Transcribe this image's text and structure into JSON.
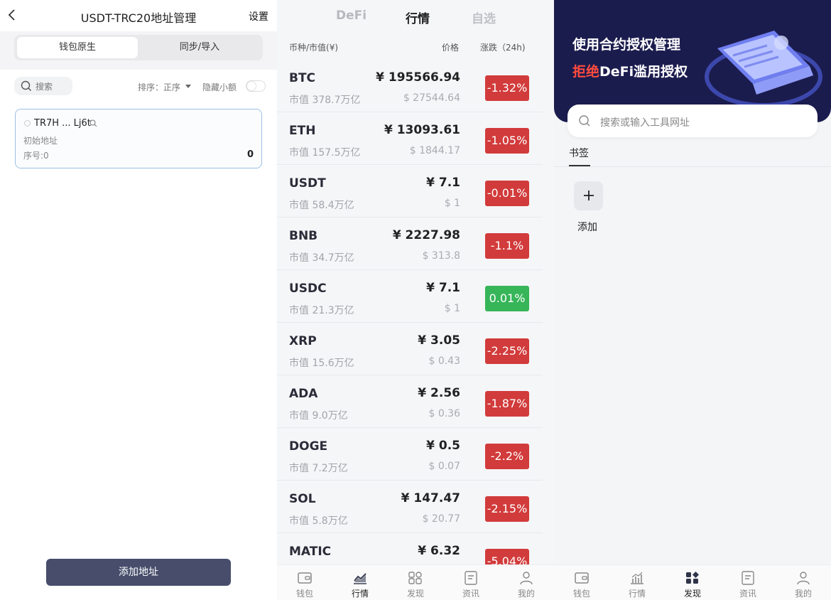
{
  "left": {
    "title": "USDT-TRC20地址管理",
    "settings": "设置",
    "segments": [
      "钱包原生",
      "同步/导入"
    ],
    "search_placeholder": "搜索",
    "sort_label": "排序：正序",
    "hide_small": "隐藏小额",
    "card": {
      "address": "TR7H ... Lj6t",
      "note": "初始地址",
      "seq": "序号:0",
      "balance": "0"
    },
    "add_button": "添加地址"
  },
  "middle": {
    "tabs": [
      "DeFi",
      "行情",
      "自选"
    ],
    "headers": {
      "coin": "币种/市值(¥)",
      "price": "价格",
      "change": "涨跌（24h)"
    },
    "rows": [
      {
        "sym": "BTC",
        "cap": "市值 378.7万亿",
        "price": "¥ 195566.94",
        "usd": "$ 27544.64",
        "chg": "-1.32%",
        "dir": "down"
      },
      {
        "sym": "ETH",
        "cap": "市值 157.5万亿",
        "price": "¥ 13093.61",
        "usd": "$ 1844.17",
        "chg": "-1.05%",
        "dir": "down"
      },
      {
        "sym": "USDT",
        "cap": "市值 58.4万亿",
        "price": "¥ 7.1",
        "usd": "$ 1",
        "chg": "-0.01%",
        "dir": "down"
      },
      {
        "sym": "BNB",
        "cap": "市值 34.7万亿",
        "price": "¥ 2227.98",
        "usd": "$ 313.8",
        "chg": "-1.1%",
        "dir": "down"
      },
      {
        "sym": "USDC",
        "cap": "市值 21.3万亿",
        "price": "¥ 7.1",
        "usd": "$ 1",
        "chg": "0.01%",
        "dir": "up"
      },
      {
        "sym": "XRP",
        "cap": "市值 15.6万亿",
        "price": "¥ 3.05",
        "usd": "$ 0.43",
        "chg": "-2.25%",
        "dir": "down"
      },
      {
        "sym": "ADA",
        "cap": "市值 9.0万亿",
        "price": "¥ 2.56",
        "usd": "$ 0.36",
        "chg": "-1.87%",
        "dir": "down"
      },
      {
        "sym": "DOGE",
        "cap": "市值 7.2万亿",
        "price": "¥ 0.5",
        "usd": "$ 0.07",
        "chg": "-2.2%",
        "dir": "down"
      },
      {
        "sym": "SOL",
        "cap": "市值 5.8万亿",
        "price": "¥ 147.47",
        "usd": "$ 20.77",
        "chg": "-2.15%",
        "dir": "down"
      },
      {
        "sym": "MATIC",
        "cap": "",
        "price": "¥ 6.32",
        "usd": "",
        "chg": "-5.04%",
        "dir": "down"
      }
    ],
    "nav": [
      "钱包",
      "行情",
      "发现",
      "资讯",
      "我的"
    ]
  },
  "right": {
    "banner_line1": "使用合约授权管理",
    "banner_line2_highlight": "拒绝",
    "banner_line2_rest": "DeFi滥用授权",
    "search_placeholder": "搜索或输入工具网址",
    "bookmark_tab": "书签",
    "add_label": "添加",
    "nav": [
      "钱包",
      "行情",
      "发现",
      "资讯",
      "我的"
    ]
  },
  "colors": {
    "down": "#d23b3b",
    "up": "#36b559",
    "banner": "#1b1c4e",
    "primary_button": "#474d6b",
    "highlight": "#ff4b3e"
  }
}
